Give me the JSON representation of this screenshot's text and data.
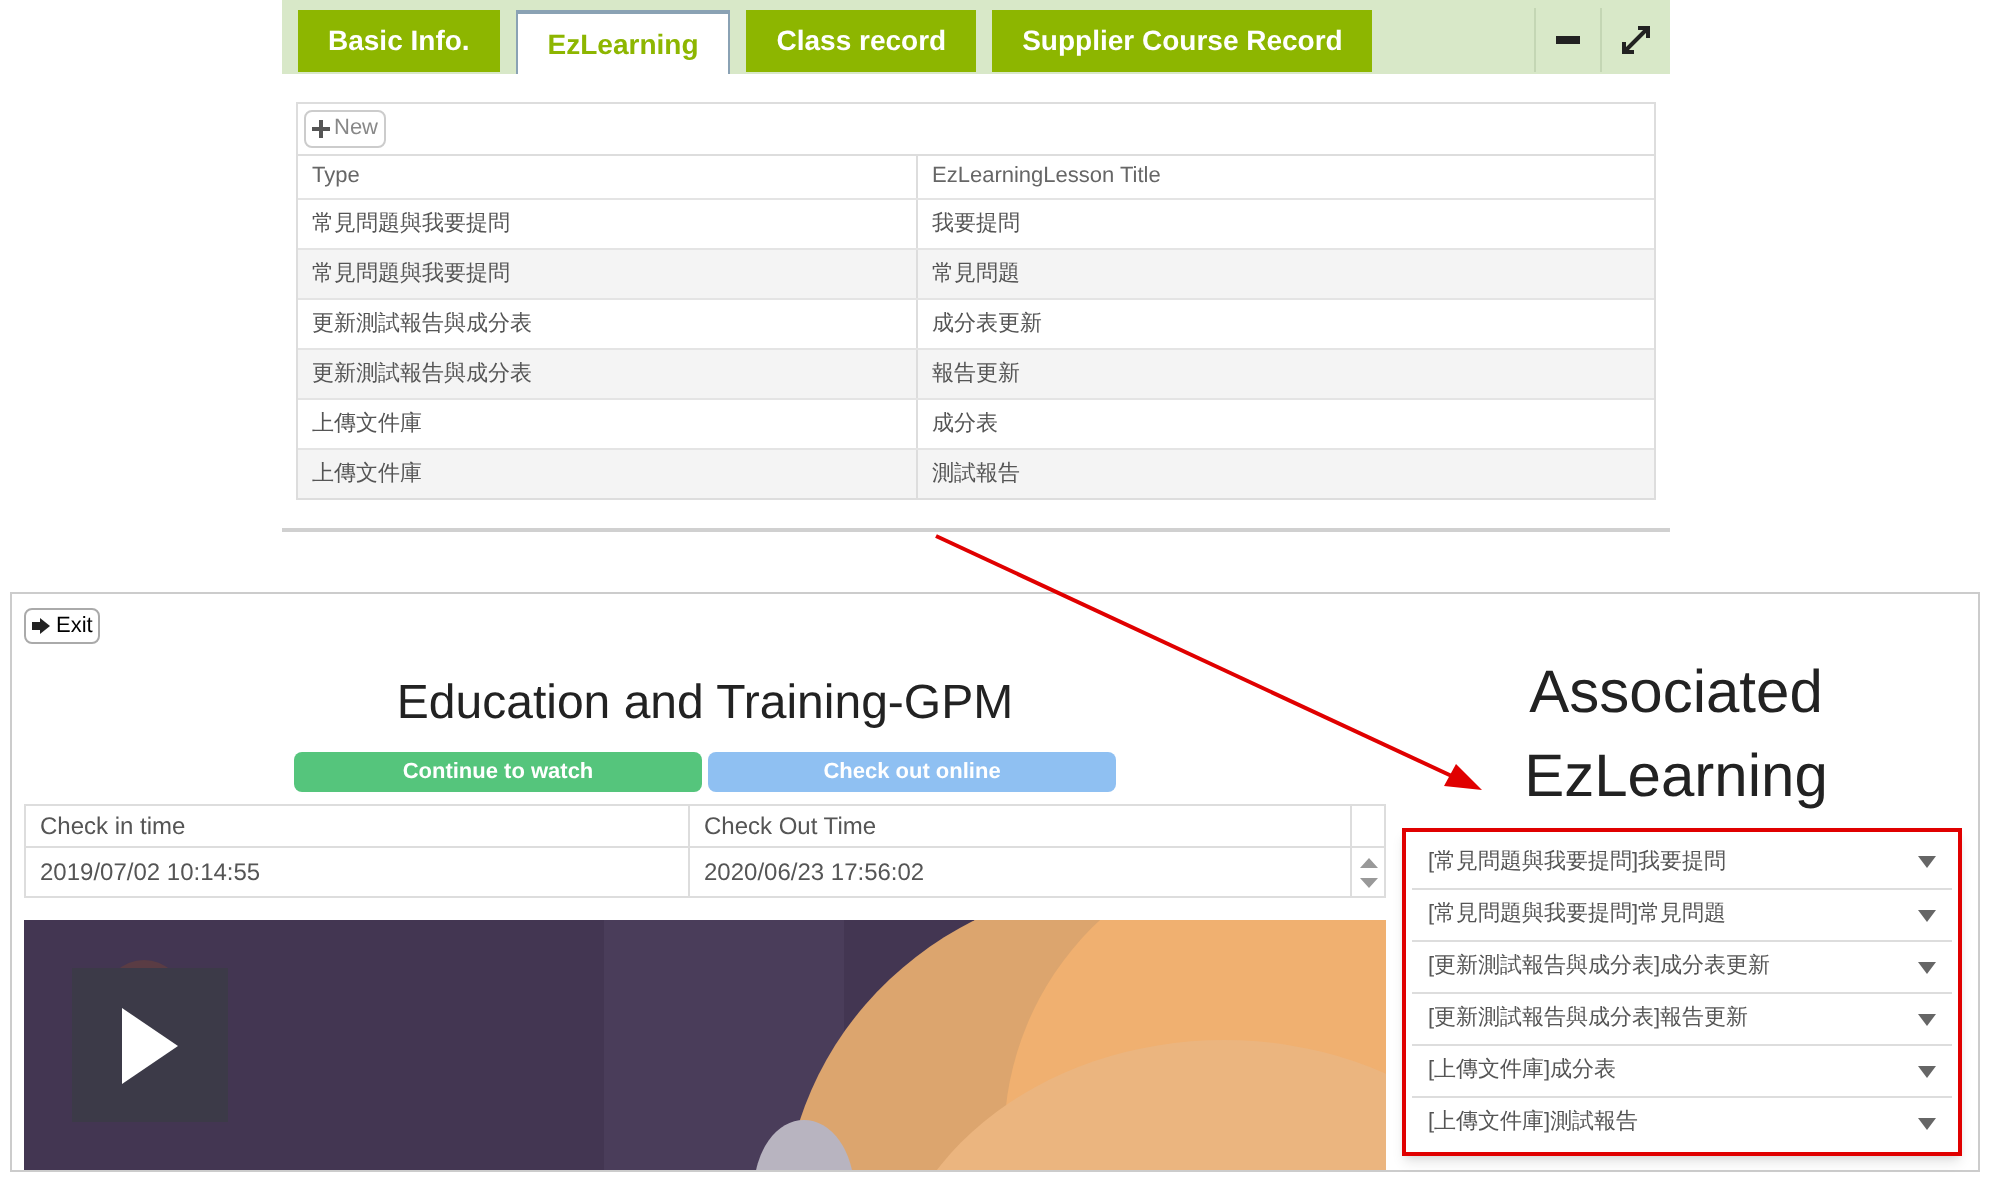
{
  "tabs": [
    {
      "label": "Basic Info.",
      "selected": false
    },
    {
      "label": "EzLearning",
      "selected": true
    },
    {
      "label": "Class record",
      "selected": false
    },
    {
      "label": "Supplier Course Record",
      "selected": false
    }
  ],
  "new_button": "New",
  "table": {
    "columns": [
      "Type",
      "EzLearningLesson Title"
    ],
    "rows": [
      [
        "常見問題與我要提問",
        "我要提問"
      ],
      [
        "常見問題與我要提問",
        "常見問題"
      ],
      [
        "更新測試報告與成分表",
        "成分表更新"
      ],
      [
        "更新測試報告與成分表",
        "報告更新"
      ],
      [
        "上傳文件庫",
        "成分表"
      ],
      [
        "上傳文件庫",
        "測試報告"
      ]
    ]
  },
  "player": {
    "exit_button": "Exit",
    "title": "Education and Training-GPM",
    "buttons": [
      {
        "label": "Continue to watch",
        "kind": "primary"
      },
      {
        "label": "Check out online",
        "kind": "secondary"
      }
    ],
    "times": {
      "columns": [
        "Check in time",
        "Check Out Time"
      ],
      "rows": [
        [
          "2019/07/02 10:14:55",
          "2020/06/23 17:56:02"
        ]
      ]
    },
    "associated_title": "Associated EzLearning",
    "associated_items": [
      "[常見問題與我要提問]我要提問",
      "[常見問題與我要提問]常見問題",
      "[更新測試報告與成分表]成分表更新",
      "[更新測試報告與成分表]報告更新",
      "[上傳文件庫]成分表",
      "[上傳文件庫]測試報告"
    ]
  }
}
